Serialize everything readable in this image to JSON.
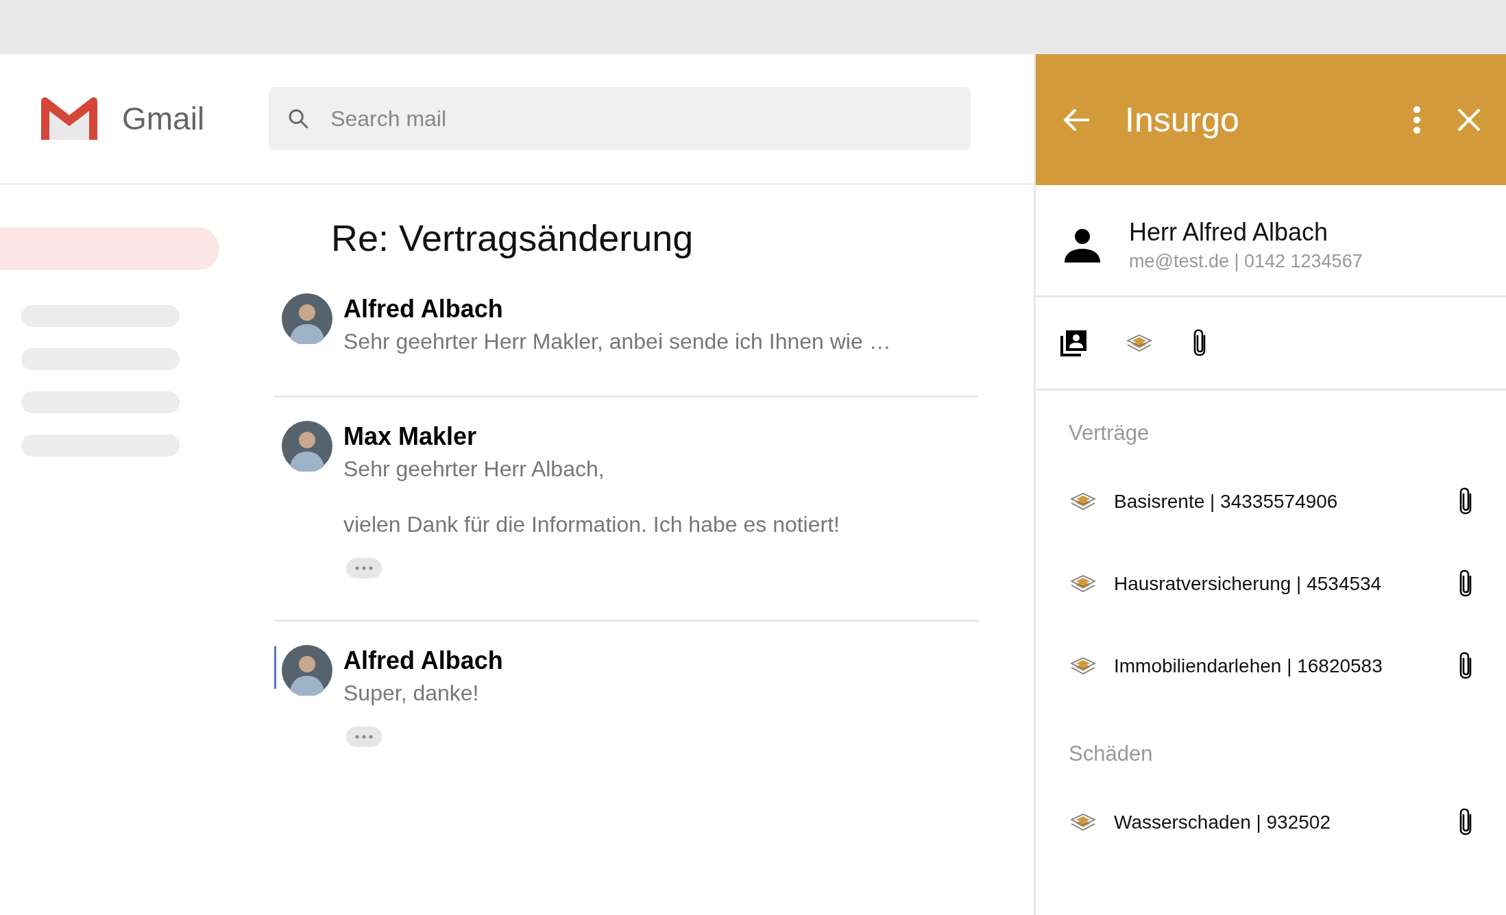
{
  "mail_header": {
    "logo_text": "Gmail",
    "search": {
      "placeholder": "Search mail"
    }
  },
  "sidebar": {
    "items": [
      {
        "selected": true
      },
      {
        "selected": false
      },
      {
        "selected": false
      },
      {
        "selected": false
      },
      {
        "selected": false
      }
    ]
  },
  "thread": {
    "subject": "Re: Vertragsänderung",
    "messages": [
      {
        "sender": "Alfred Albach",
        "lines": [
          "Sehr geehrter Herr Makler, anbei sende ich Ihnen wie …"
        ],
        "trimmed_content": false,
        "focused": false
      },
      {
        "sender": "Max Makler",
        "lines": [
          "Sehr geehrter Herr Albach,",
          "vielen Dank für die Information. Ich habe es notiert!"
        ],
        "trimmed_content": true,
        "focused": false
      },
      {
        "sender": "Alfred Albach",
        "lines": [
          "Super, danke!"
        ],
        "trimmed_content": true,
        "focused": true
      }
    ]
  },
  "panel": {
    "title": "Insurgo",
    "contact": {
      "name": "Herr Alfred Albach",
      "details": "me@test.de | 0142 1234567"
    },
    "tabs": [
      {
        "kind": "contacts"
      },
      {
        "kind": "contracts"
      },
      {
        "kind": "attachments"
      }
    ],
    "sections": [
      {
        "title": "Verträge",
        "items": [
          {
            "label": "Basisrente | 34335574906"
          },
          {
            "label": "Hausratversicherung | 4534534"
          },
          {
            "label": "Immobiliendarlehen | 16820583"
          }
        ]
      },
      {
        "title": "Schäden",
        "items": [
          {
            "label": "Wasserschaden | 932502"
          }
        ]
      }
    ]
  }
}
